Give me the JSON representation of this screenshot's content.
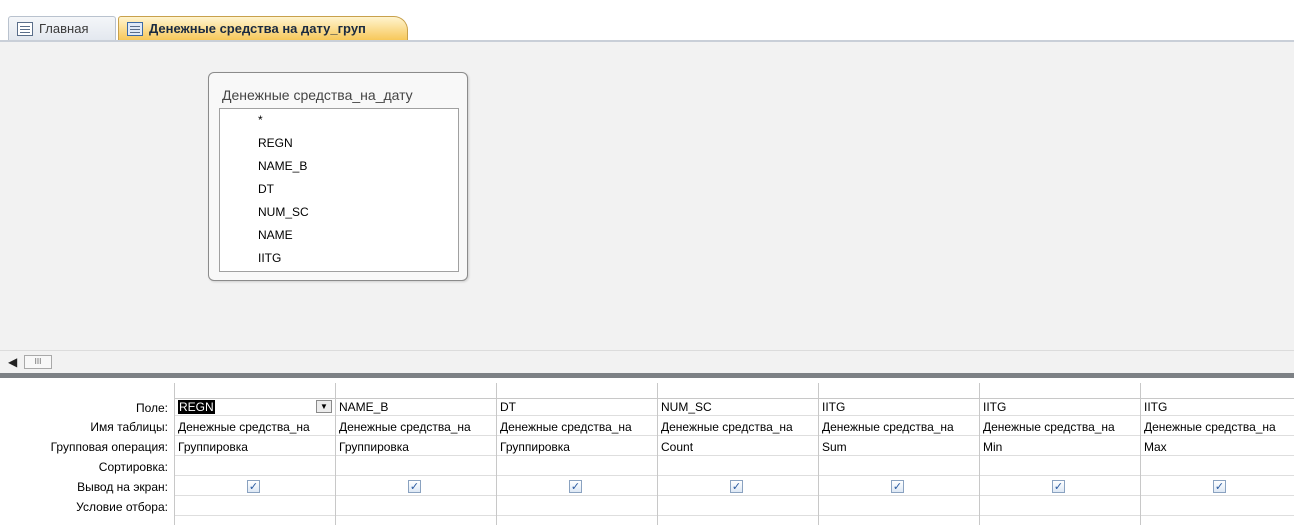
{
  "tabs": [
    {
      "label": "Главная",
      "icon": "form-icon"
    },
    {
      "label": "Денежные средства на дату_груп",
      "icon": "query-icon"
    }
  ],
  "table_box": {
    "title": "Денежные средства_на_дату",
    "fields": [
      "*",
      "REGN",
      "NAME_B",
      "DT",
      "NUM_SC",
      "NAME",
      "IITG"
    ]
  },
  "scrollbar": {
    "thumb_glyph": "III",
    "left_arrow": "◀"
  },
  "grid": {
    "row_labels": [
      "Поле:",
      "Имя таблицы:",
      "Групповая операция:",
      "Сортировка:",
      "Вывод на экран:",
      "Условие отбора:"
    ],
    "columns": [
      {
        "field": "REGN",
        "table": "Денежные средства_на",
        "group": "Группировка",
        "sort": "",
        "show": true,
        "criteria": ""
      },
      {
        "field": "NAME_B",
        "table": "Денежные средства_на",
        "group": "Группировка",
        "sort": "",
        "show": true,
        "criteria": ""
      },
      {
        "field": "DT",
        "table": "Денежные средства_на",
        "group": "Группировка",
        "sort": "",
        "show": true,
        "criteria": ""
      },
      {
        "field": "NUM_SC",
        "table": "Денежные средства_на",
        "group": "Count",
        "sort": "",
        "show": true,
        "criteria": ""
      },
      {
        "field": "IITG",
        "table": "Денежные средства_на",
        "group": "Sum",
        "sort": "",
        "show": true,
        "criteria": ""
      },
      {
        "field": "IITG",
        "table": "Денежные средства_на",
        "group": "Min",
        "sort": "",
        "show": true,
        "criteria": ""
      },
      {
        "field": "IITG",
        "table": "Денежные средства_на",
        "group": "Max",
        "sort": "",
        "show": true,
        "criteria": ""
      }
    ],
    "dropdown_glyph": "▼",
    "check_glyph": "✓"
  },
  "colors": {
    "active_tab": "#f7c85a",
    "design_bg": "#f2f2f2",
    "splitter": "#7d8185"
  }
}
